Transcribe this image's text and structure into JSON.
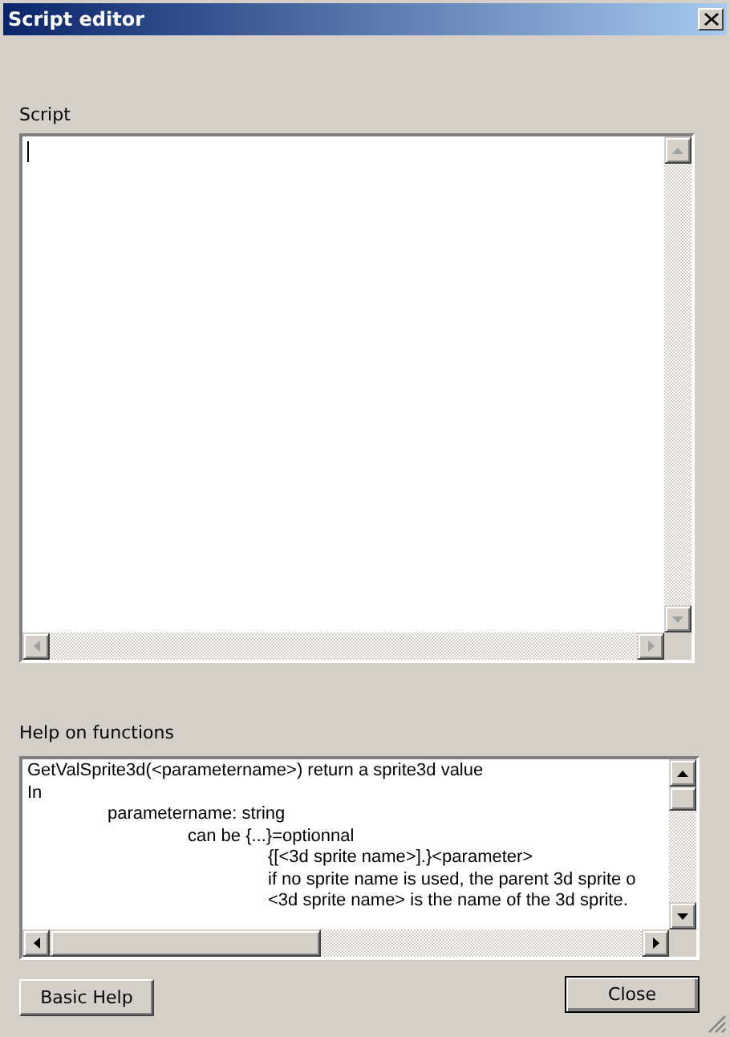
{
  "window": {
    "title": "Script editor"
  },
  "script": {
    "label": "Script"
  },
  "help": {
    "label": "Help on functions",
    "lines": [
      "GetValSprite3d(<parametername>) return a sprite3d value",
      "In",
      "\tparametername: string",
      "\t\tcan be {...}=optionnal",
      "\t\t\t{[<3d sprite name>].}<parameter>",
      "\t\t\tif no sprite name is used, the parent 3d sprite o",
      "\t\t\t<3d sprite name> is the name of the 3d sprite."
    ]
  },
  "buttons": [
    "Basic Help",
    "Close"
  ]
}
